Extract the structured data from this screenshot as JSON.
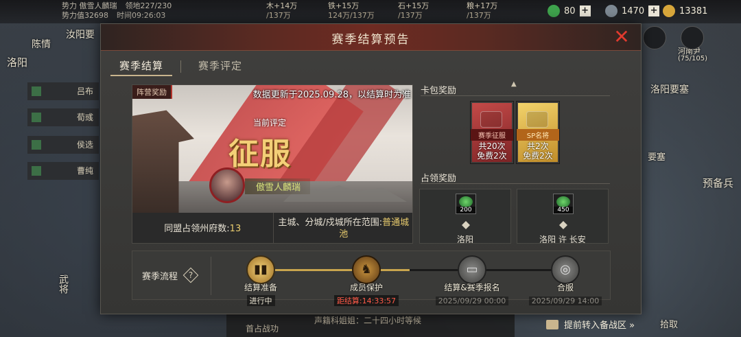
{
  "topbar": {
    "player_line1": "势力 傲雪人麟瑞",
    "player_line2": "势力值32698",
    "troop_label": "领地227/230",
    "time_label": "时间09:26:03",
    "resources": [
      {
        "rate": "木+14万",
        "total": "/137万"
      },
      {
        "rate": "铁+15万",
        "total": "124万/137万"
      },
      {
        "rate": "石+15万",
        "total": "/137万"
      },
      {
        "rate": "粮+17万",
        "total": "/137万"
      }
    ],
    "currencies": [
      {
        "value": "80",
        "icon": "jade-coin-icon",
        "color": "#3fa34d"
      },
      {
        "value": "1470",
        "icon": "silver-coin-icon",
        "color": "#7e8a94"
      },
      {
        "value": "13381",
        "icon": "gold-coin-icon",
        "color": "#d7a63a"
      }
    ]
  },
  "background": {
    "side_generals": [
      "吕布",
      "荀彧",
      "侯选",
      "曹纯"
    ],
    "labels": [
      "陈情",
      "洛阳",
      "汝阳要",
      "洛阳要塞",
      "预备兵",
      "要塞",
      "河南尹",
      "(75/105)",
      "首占战功",
      "声籍科姐姐：二十四小时等候",
      "武将",
      "拾取"
    ]
  },
  "modal": {
    "title": "赛季结算预告",
    "tabs": [
      {
        "label": "赛季结算"
      },
      {
        "label": "赛季评定"
      }
    ],
    "season": {
      "camp_tag": "阵营奖励",
      "update_note": "数据更新于2025.09.28，以结算时为准",
      "rating_label": "当前评定",
      "rating_value": "征服",
      "leader_name": "傲雪人麟瑞",
      "stat_left_label": "同盟占领州府数:",
      "stat_left_value": "13",
      "stat_right_label": "主城、分城/戍城所在范围:",
      "stat_right_value": "普通城池"
    },
    "card_rewards": {
      "title": "卡包奖励",
      "packs": [
        {
          "name": "赛季征服",
          "count": "共20次",
          "free": "免费2次",
          "style": "red"
        },
        {
          "name": "SP名将",
          "count": "共2次",
          "free": "免费2次",
          "style": "gold"
        }
      ]
    },
    "occupy_rewards": {
      "title": "占领奖励",
      "items": [
        {
          "amount": "200",
          "city": "洛阳"
        },
        {
          "amount": "450",
          "city": "洛阳 许 长安"
        }
      ]
    },
    "flow": {
      "label": "赛季流程",
      "help": "?",
      "stages": [
        {
          "title": "结算准备",
          "sub": "进行中",
          "state": "done",
          "sub_style": "progress"
        },
        {
          "title": "成员保护",
          "sub": "距结算:14:33:57",
          "state": "active",
          "sub_style": "timer"
        },
        {
          "title": "结算&赛季报名",
          "sub": "2025/09/29 00:00",
          "state": "todo",
          "sub_style": "date"
        },
        {
          "title": "合服",
          "sub": "2025/09/29 14:00",
          "state": "todo",
          "sub_style": "date"
        }
      ]
    }
  },
  "footer": {
    "prep_link": "提前转入备战区 »"
  }
}
